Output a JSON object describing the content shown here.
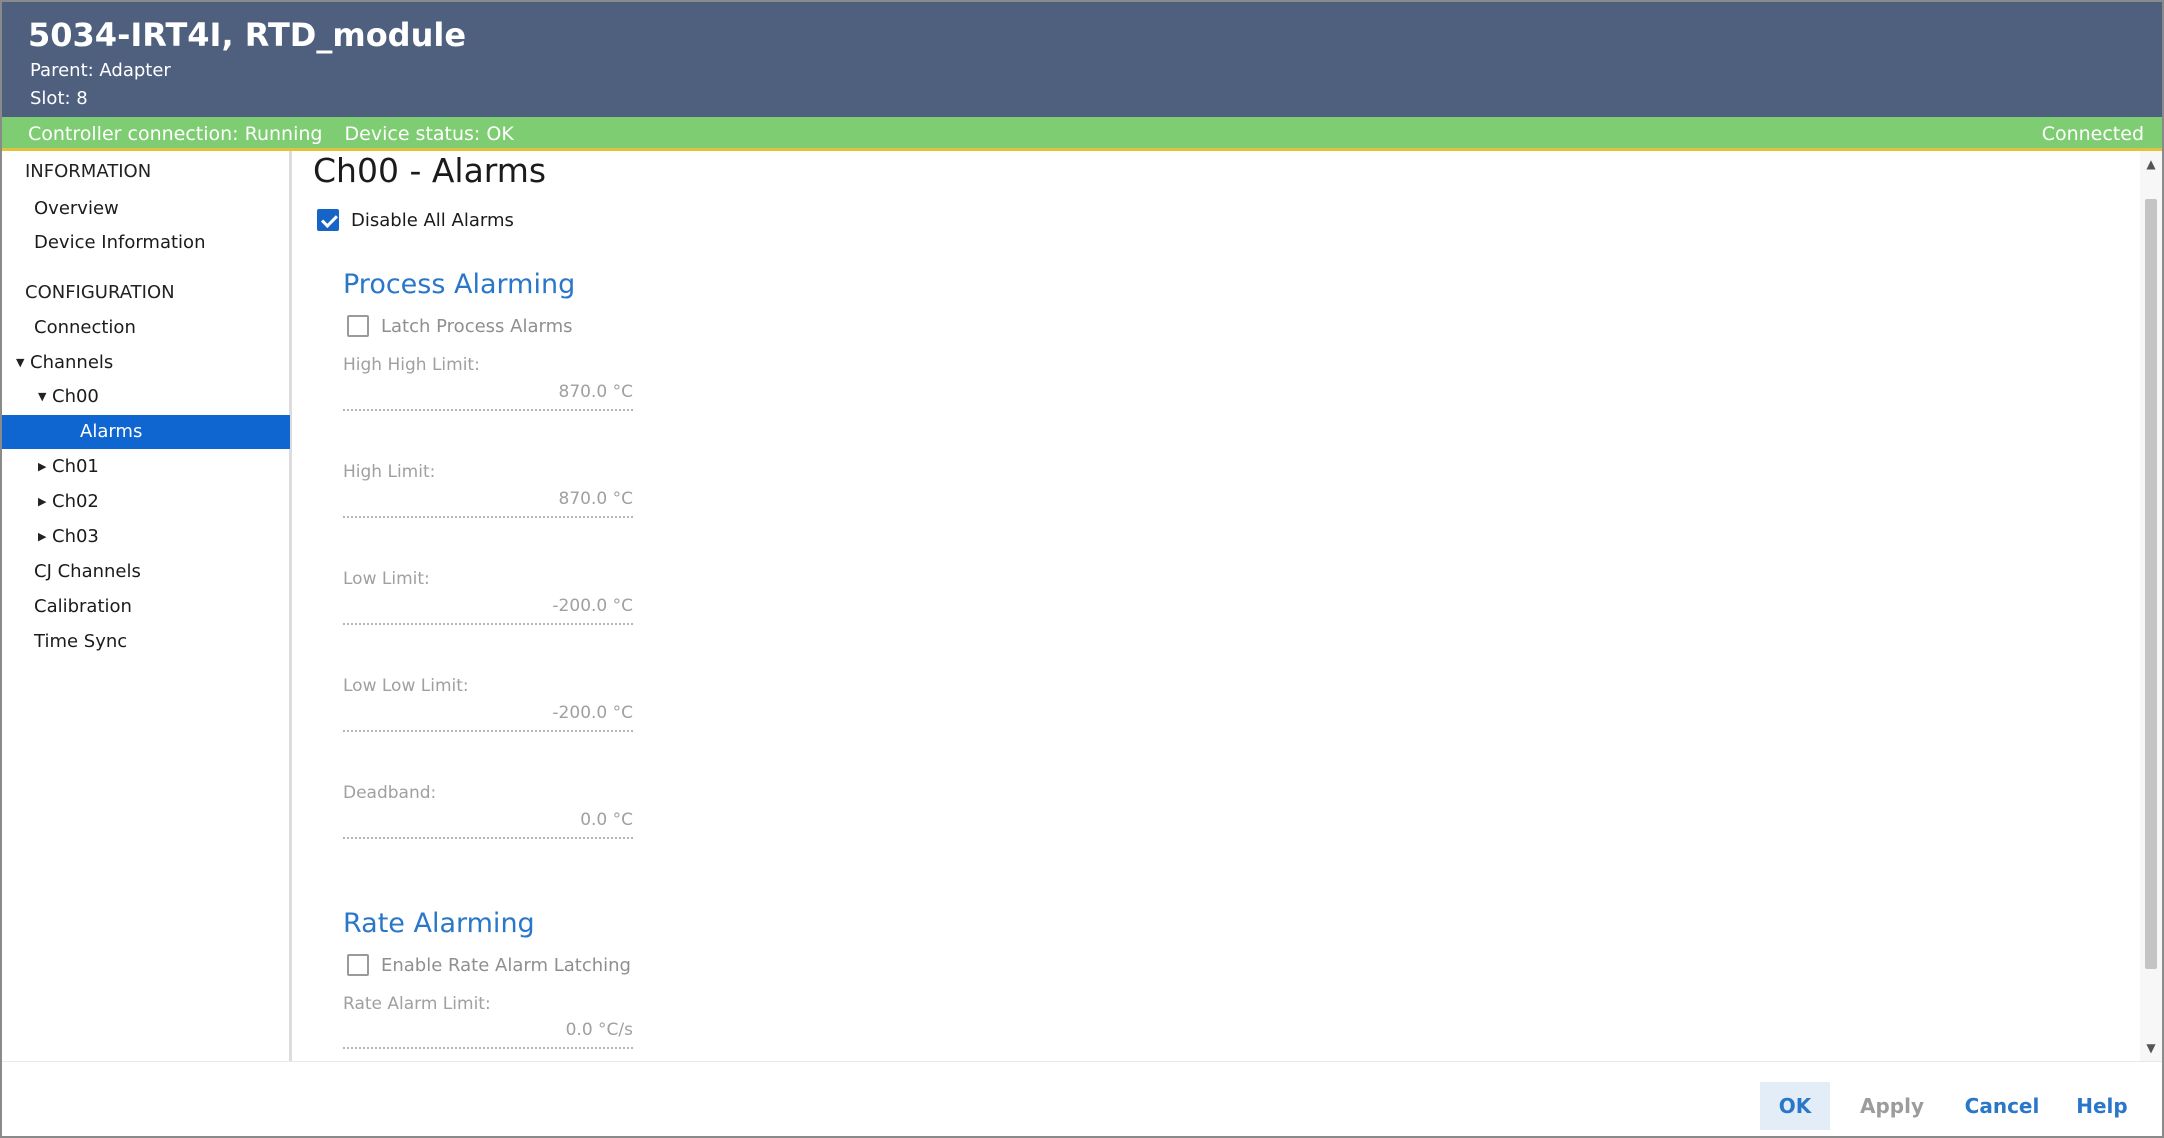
{
  "header": {
    "title": "5034-IRT4I, RTD_module",
    "parent": "Parent: Adapter",
    "slot": "Slot: 8"
  },
  "status": {
    "controller_connection": "Controller connection: Running",
    "device_status": "Device status: OK",
    "connected": "Connected",
    "bar_color": "#7fcd72"
  },
  "sidebar": {
    "information_heading": "INFORMATION",
    "overview": "Overview",
    "device_information": "Device Information",
    "configuration_heading": "CONFIGURATION",
    "connection": "Connection",
    "channels": "Channels",
    "ch00": "Ch00",
    "alarms": "Alarms",
    "ch01": "Ch01",
    "ch02": "Ch02",
    "ch03": "Ch03",
    "cj_channels": "CJ Channels",
    "calibration": "Calibration",
    "time_sync": "Time Sync",
    "active_color": "#0f66d0"
  },
  "main": {
    "title": "Ch00 - Alarms",
    "disable_all_alarms": {
      "label": "Disable All Alarms",
      "checked": true
    },
    "process_alarming": {
      "title": "Process Alarming",
      "latch_label": "Latch Process Alarms",
      "latch_checked": false,
      "fields": [
        {
          "label": "High High Limit:",
          "value": "870.0 °C"
        },
        {
          "label": "High Limit:",
          "value": "870.0 °C"
        },
        {
          "label": "Low Limit:",
          "value": "-200.0 °C"
        },
        {
          "label": "Low Low Limit:",
          "value": "-200.0 °C"
        },
        {
          "label": "Deadband:",
          "value": "0.0 °C"
        }
      ]
    },
    "rate_alarming": {
      "title": "Rate Alarming",
      "latch_label": "Enable Rate Alarm Latching",
      "latch_checked": false,
      "fields": [
        {
          "label": "Rate Alarm Limit:",
          "value": "0.0 °C/s"
        }
      ]
    }
  },
  "footer": {
    "ok": "OK",
    "apply": "Apply",
    "cancel": "Cancel",
    "help": "Help"
  }
}
